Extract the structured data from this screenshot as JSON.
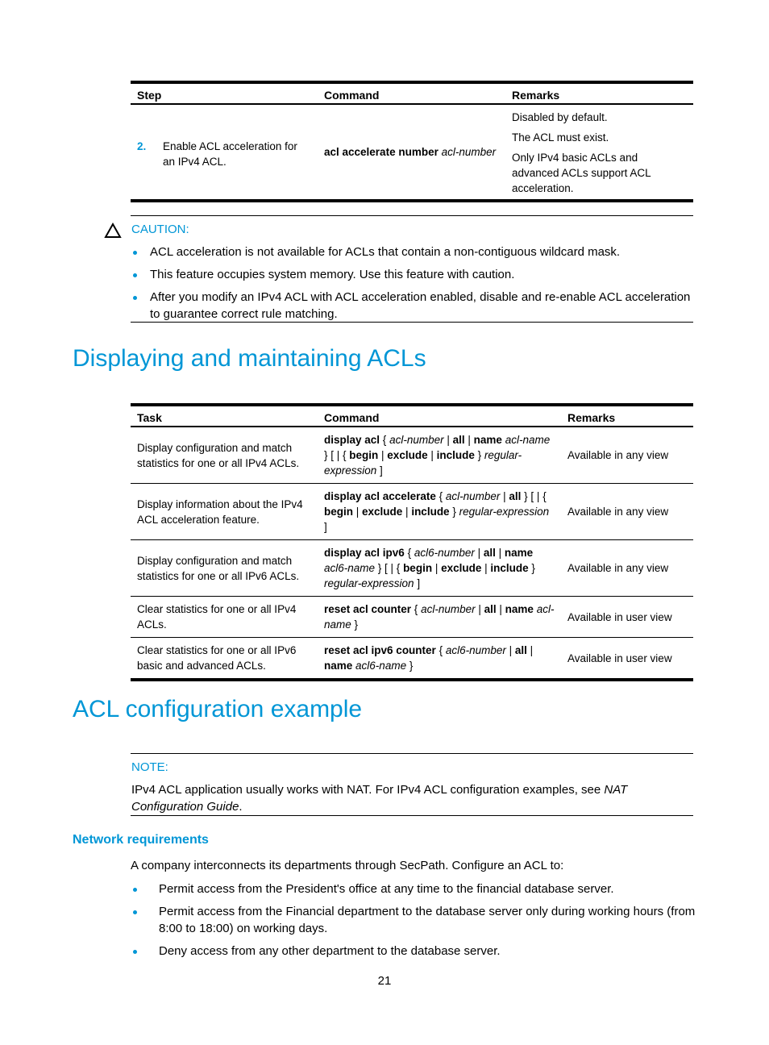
{
  "colors": {
    "accent": "#0096d6",
    "text": "#000000"
  },
  "step_table": {
    "headers": [
      "Step",
      "Command",
      "Remarks"
    ],
    "rows": [
      {
        "step_number": "2.",
        "step_text": "Enable ACL acceleration for an IPv4 ACL.",
        "command": [
          {
            "text": "acl accelerate number ",
            "style": "b"
          },
          {
            "text": "acl-number",
            "style": "i"
          }
        ],
        "remarks": [
          "Disabled by default.",
          "The ACL must exist.",
          "Only IPv4 basic ACLs and advanced ACLs support ACL acceleration."
        ]
      }
    ]
  },
  "caution": {
    "icon": "warning-triangle-icon",
    "label": "CAUTION:",
    "items": [
      "ACL acceleration is not available for ACLs that contain a non-contiguous wildcard mask.",
      "This feature occupies system memory. Use this feature with caution.",
      "After you modify an IPv4 ACL with ACL acceleration enabled, disable and re-enable ACL acceleration to guarantee correct rule matching."
    ]
  },
  "section1": {
    "title": "Displaying and maintaining ACLs"
  },
  "task_table": {
    "headers": [
      "Task",
      "Command",
      "Remarks"
    ],
    "rows": [
      {
        "task": "Display configuration and match statistics for one or all IPv4 ACLs.",
        "command": [
          {
            "text": "display acl",
            "style": "b"
          },
          {
            "text": " { ",
            "style": ""
          },
          {
            "text": "acl-number",
            "style": "i"
          },
          {
            "text": " | ",
            "style": ""
          },
          {
            "text": "all",
            "style": "b"
          },
          {
            "text": " | ",
            "style": ""
          },
          {
            "text": "name",
            "style": "b"
          },
          {
            "text": " ",
            "style": ""
          },
          {
            "text": "acl-name",
            "style": "i"
          },
          {
            "text": " } [ | { ",
            "style": ""
          },
          {
            "text": "begin",
            "style": "b"
          },
          {
            "text": " | ",
            "style": ""
          },
          {
            "text": "exclude",
            "style": "b"
          },
          {
            "text": " | ",
            "style": ""
          },
          {
            "text": "include",
            "style": "b"
          },
          {
            "text": " } ",
            "style": ""
          },
          {
            "text": "regular-expression",
            "style": "i"
          },
          {
            "text": " ]",
            "style": ""
          }
        ],
        "remarks": "Available in any view"
      },
      {
        "task": "Display information about the IPv4 ACL acceleration feature.",
        "command": [
          {
            "text": "display acl accelerate",
            "style": "b"
          },
          {
            "text": " { ",
            "style": ""
          },
          {
            "text": "acl-number",
            "style": "i"
          },
          {
            "text": " | ",
            "style": ""
          },
          {
            "text": "all",
            "style": "b"
          },
          {
            "text": " } [ | { ",
            "style": ""
          },
          {
            "text": "begin",
            "style": "b"
          },
          {
            "text": " | ",
            "style": ""
          },
          {
            "text": "exclude",
            "style": "b"
          },
          {
            "text": " | ",
            "style": ""
          },
          {
            "text": "include",
            "style": "b"
          },
          {
            "text": " } ",
            "style": ""
          },
          {
            "text": "regular-expression",
            "style": "i"
          },
          {
            "text": " ]",
            "style": ""
          }
        ],
        "remarks": "Available in any view"
      },
      {
        "task": "Display configuration and match statistics for one or all IPv6 ACLs.",
        "command": [
          {
            "text": "display acl ipv6",
            "style": "b"
          },
          {
            "text": " { ",
            "style": ""
          },
          {
            "text": "acl6-number",
            "style": "i"
          },
          {
            "text": " | ",
            "style": ""
          },
          {
            "text": "all",
            "style": "b"
          },
          {
            "text": " | ",
            "style": ""
          },
          {
            "text": "name",
            "style": "b"
          },
          {
            "text": " ",
            "style": ""
          },
          {
            "text": "acl6-name",
            "style": "i"
          },
          {
            "text": " } [ | { ",
            "style": ""
          },
          {
            "text": "begin",
            "style": "b"
          },
          {
            "text": " | ",
            "style": ""
          },
          {
            "text": "exclude",
            "style": "b"
          },
          {
            "text": " | ",
            "style": ""
          },
          {
            "text": "include",
            "style": "b"
          },
          {
            "text": " } ",
            "style": ""
          },
          {
            "text": "regular-expression",
            "style": "i"
          },
          {
            "text": " ]",
            "style": ""
          }
        ],
        "remarks": "Available in any view"
      },
      {
        "task": "Clear statistics for one or all IPv4 ACLs.",
        "command": [
          {
            "text": "reset acl counter",
            "style": "b"
          },
          {
            "text": " { ",
            "style": ""
          },
          {
            "text": "acl-number",
            "style": "i"
          },
          {
            "text": " | ",
            "style": ""
          },
          {
            "text": "all",
            "style": "b"
          },
          {
            "text": " | ",
            "style": ""
          },
          {
            "text": "name",
            "style": "b"
          },
          {
            "text": " ",
            "style": ""
          },
          {
            "text": "acl-name",
            "style": "i"
          },
          {
            "text": " }",
            "style": ""
          }
        ],
        "remarks": "Available in user view"
      },
      {
        "task": "Clear statistics for one or all IPv6 basic and advanced ACLs.",
        "command": [
          {
            "text": "reset acl ipv6 counter",
            "style": "b"
          },
          {
            "text": " { ",
            "style": ""
          },
          {
            "text": "acl6-number",
            "style": "i"
          },
          {
            "text": " | ",
            "style": ""
          },
          {
            "text": "all",
            "style": "b"
          },
          {
            "text": " | ",
            "style": ""
          },
          {
            "text": "name",
            "style": "b"
          },
          {
            "text": " ",
            "style": ""
          },
          {
            "text": "acl6-name",
            "style": "i"
          },
          {
            "text": " }",
            "style": ""
          }
        ],
        "remarks": "Available in user view"
      }
    ]
  },
  "section2": {
    "title": "ACL configuration example"
  },
  "note": {
    "label": "NOTE:",
    "text": [
      {
        "text": "IPv4 ACL application usually works with NAT. For IPv4 ACL configuration examples, see ",
        "style": ""
      },
      {
        "text": "NAT Configuration Guide",
        "style": "i"
      },
      {
        "text": ".",
        "style": ""
      }
    ]
  },
  "subsection": {
    "title": "Network requirements",
    "intro": "A company interconnects its departments through SecPath. Configure an ACL to:",
    "items": [
      "Permit access from the President's office at any time to the financial database server.",
      "Permit access from the Financial department to the database server only during working hours (from 8:00 to 18:00) on working days.",
      "Deny access from any other department to the database server."
    ]
  },
  "footer": {
    "page_number": "21"
  }
}
